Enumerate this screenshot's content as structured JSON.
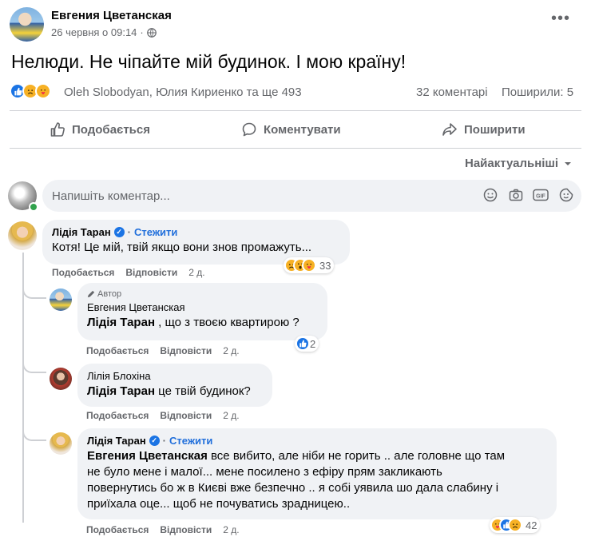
{
  "post": {
    "author": "Евгения Цветанская",
    "date": "26 червня о 09:14",
    "dot": "·",
    "privacy_icon": "globe-icon",
    "more_icon": "•••",
    "text": "Нелюди. Не чіпайте мій будинок. І мою країну!",
    "reactions_names": "Oleh Slobodyan, Юлия Кириенко та ще 493",
    "comments_count": "32 коментарі",
    "shares_count": "Поширили: 5",
    "reaction_icons": [
      "like-icon",
      "sad-icon",
      "care-icon"
    ]
  },
  "actions": {
    "like": "Подобається",
    "comment": "Коментувати",
    "share": "Поширити"
  },
  "sort": {
    "label": "Найактуальніші"
  },
  "comment_input": {
    "placeholder": "Напишіть коментар..."
  },
  "comments": [
    {
      "name": "Лідія Таран",
      "follow": "Стежити",
      "separator": "·",
      "text": "Котя! Це мій, твій якщо вони знов промажуть...",
      "like": "Подобається",
      "reply": "Відповісти",
      "time": "2 д.",
      "reactions_count": "33",
      "replies": [
        {
          "author_tag": "Автор",
          "name": "Евгения Цветанская",
          "mention": "Лідія Таран",
          "text": " , що з твоєю квартирою ?",
          "like": "Подобається",
          "reply": "Відповісти",
          "time": "2 д.",
          "reactions_count": "2"
        },
        {
          "name": "Лілія Блохіна",
          "mention": "Лідія Таран",
          "text": " це твій будинок?",
          "like": "Подобається",
          "reply": "Відповісти",
          "time": "2 д."
        },
        {
          "name": "Лідія Таран",
          "follow": "Стежити",
          "separator": "·",
          "mention": "Евгения Цветанская",
          "text_lines": [
            " все вибито, але ніби не горить .. але головне що там",
            "не було мене і малої... мене посилено з ефіру прям закликають",
            "повернутись бо ж в Києві вже безпечно .. я собі уявила шо дала слабину і",
            "приїхала оце... щоб не почуватись зрадницею.."
          ],
          "like": "Подобається",
          "reply": "Відповісти",
          "time": "2 д.",
          "reactions_count": "42"
        }
      ]
    }
  ],
  "colors": {
    "accent_blue": "#216fdb",
    "like_blue": "#1b74e4",
    "muted": "#65676b",
    "bubble": "#f0f2f5"
  }
}
